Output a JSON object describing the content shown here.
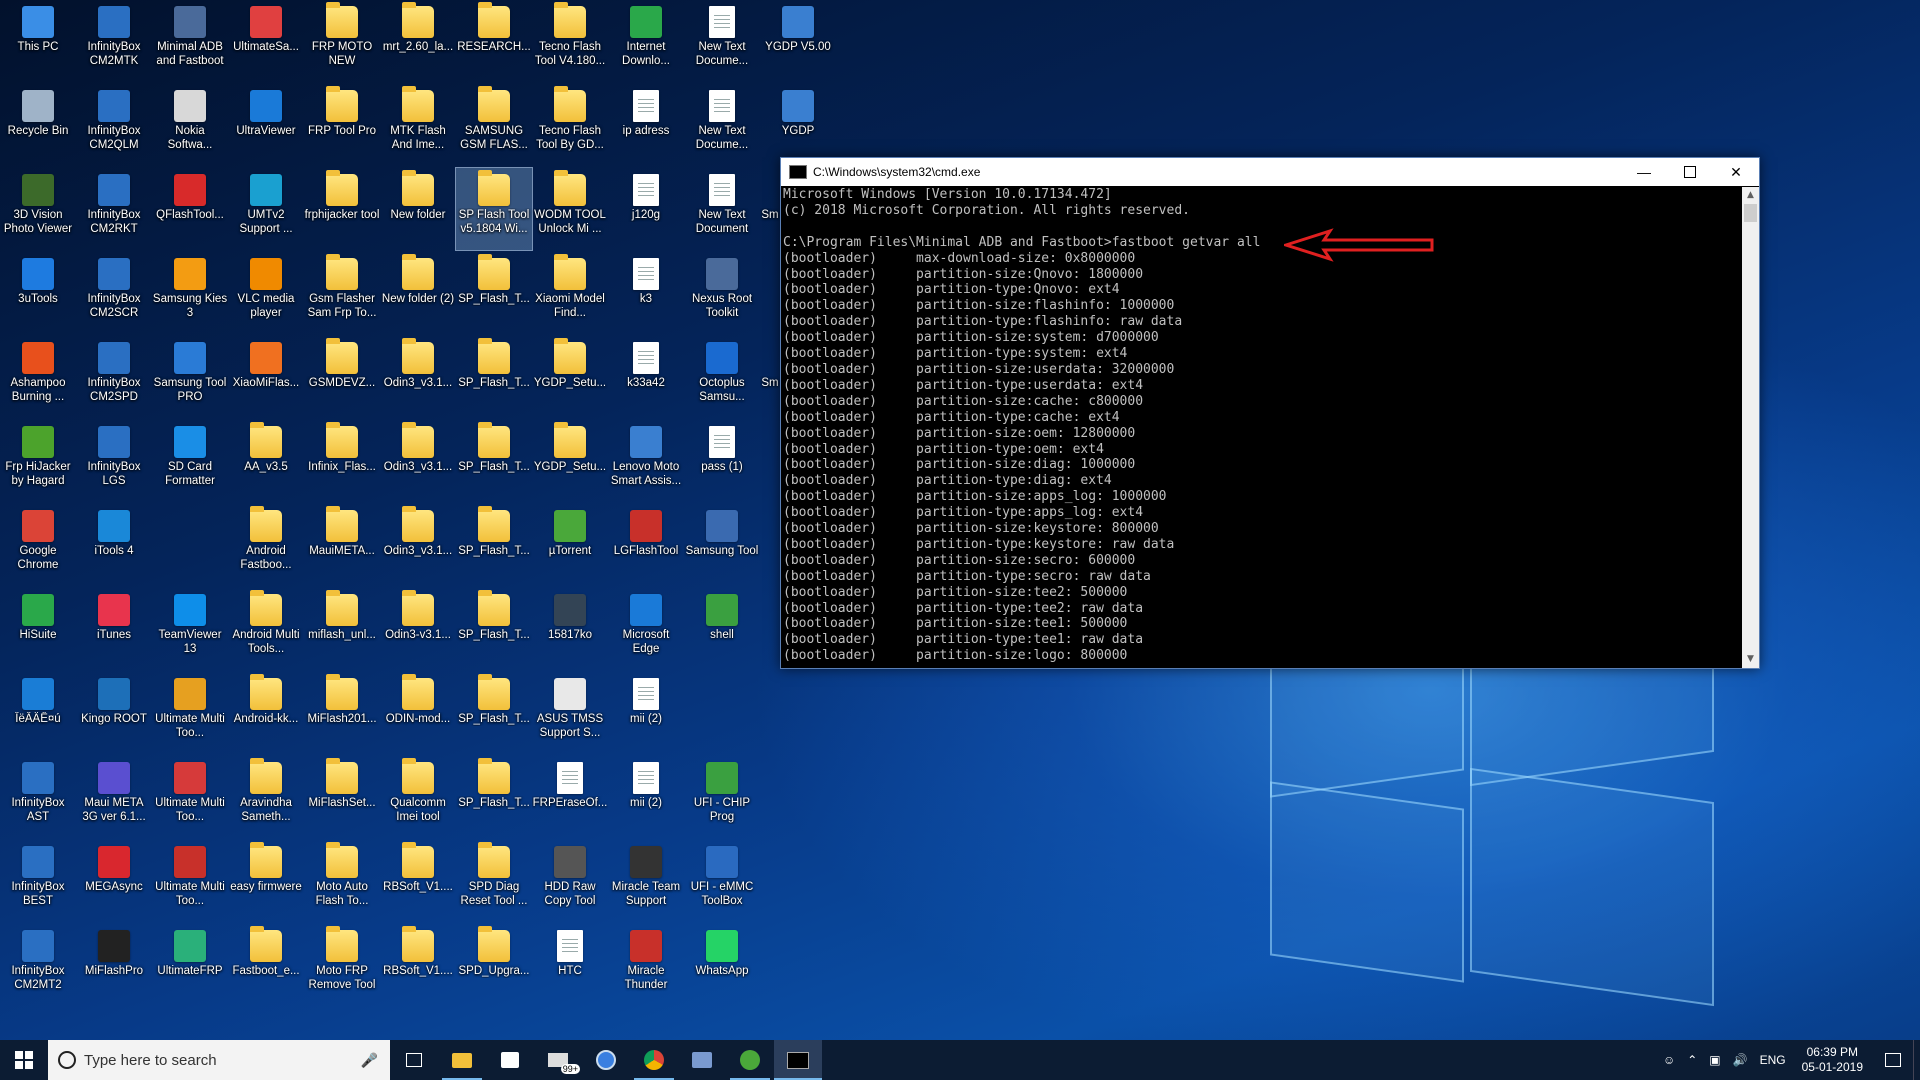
{
  "desktop": {
    "columns": [
      [
        {
          "label": "This PC",
          "icon": "this-pc-icon",
          "color": "#3a8ee6"
        },
        {
          "label": "Recycle Bin",
          "icon": "recycle-bin-icon",
          "color": "#9fb3c8"
        },
        {
          "label": "3D Vision Photo Viewer",
          "icon": "3d-vision-icon",
          "color": "#3c6a2a"
        },
        {
          "label": "3uTools",
          "icon": "3utools-icon",
          "color": "#1e7be0"
        },
        {
          "label": "Ashampoo Burning ...",
          "icon": "ashampoo-icon",
          "color": "#e8501c"
        },
        {
          "label": "Frp HiJacker by Hagard",
          "icon": "frp-hijacker-icon",
          "color": "#4ca32c"
        },
        {
          "label": "Google Chrome",
          "icon": "chrome-icon",
          "color": "#db4437"
        },
        {
          "label": "HiSuite",
          "icon": "hisuite-icon",
          "color": "#2aa84a"
        },
        {
          "label": "ÎëÂÄÊ¤ú",
          "icon": "tool-icon",
          "color": "#1a7dd6"
        },
        {
          "label": "InfinityBox AST",
          "icon": "infinitybox-icon",
          "color": "#2a6fc2"
        },
        {
          "label": "InfinityBox BEST",
          "icon": "infinitybox-icon",
          "color": "#2a6fc2"
        },
        {
          "label": "InfinityBox CM2MT2",
          "icon": "infinitybox-icon",
          "color": "#2a6fc2"
        }
      ],
      [
        {
          "label": "InfinityBox CM2MTK",
          "icon": "infinitybox-icon",
          "color": "#2a6fc2"
        },
        {
          "label": "InfinityBox CM2QLM",
          "icon": "infinitybox-icon",
          "color": "#2a6fc2"
        },
        {
          "label": "InfinityBox CM2RKT",
          "icon": "infinitybox-icon",
          "color": "#2a6fc2"
        },
        {
          "label": "InfinityBox CM2SCR",
          "icon": "infinitybox-icon",
          "color": "#2a6fc2"
        },
        {
          "label": "InfinityBox CM2SPD",
          "icon": "infinitybox-icon",
          "color": "#2a6fc2"
        },
        {
          "label": "InfinityBox LGS",
          "icon": "infinitybox-icon",
          "color": "#2a6fc2"
        },
        {
          "label": "iTools 4",
          "icon": "itools-icon",
          "color": "#1a88d8"
        },
        {
          "label": "iTunes",
          "icon": "itunes-icon",
          "color": "#e8344d"
        },
        {
          "label": "Kingo ROOT",
          "icon": "kingo-root-icon",
          "color": "#1d6fb8"
        },
        {
          "label": "Maui META 3G ver 6.1...",
          "icon": "maui-meta-icon",
          "color": "#5a4fd0"
        },
        {
          "label": "MEGAsync",
          "icon": "megasync-icon",
          "color": "#d9272e"
        },
        {
          "label": "MiFlashPro",
          "icon": "miflashpro-icon",
          "color": "#222222"
        }
      ],
      [
        {
          "label": "Minimal ADB and Fastboot",
          "icon": "adb-icon",
          "color": "#4a6a9a"
        },
        {
          "label": "Nokia Softwa...",
          "icon": "nokia-icon",
          "color": "#d8d8d8"
        },
        {
          "label": "QFlashTool...",
          "icon": "qflashtool-icon",
          "color": "#d82a2a"
        },
        {
          "label": "Samsung Kies 3",
          "icon": "kies-icon",
          "color": "#f39c12"
        },
        {
          "label": "Samsung Tool PRO",
          "icon": "samsung-tool-icon",
          "color": "#2a7bd6"
        },
        {
          "label": "SD Card Formatter",
          "icon": "sd-card-icon",
          "color": "#1a8ee6"
        },
        {
          "label": "",
          "icon": "",
          "color": ""
        },
        {
          "label": "TeamViewer 13",
          "icon": "teamviewer-icon",
          "color": "#0e8ee9"
        },
        {
          "label": "Ultimate Multi Too...",
          "icon": "ultimate-multi-tool-icon",
          "color": "#e6a020"
        },
        {
          "label": "Ultimate Multi Too...",
          "icon": "ultimate-multi-tool-icon",
          "color": "#d63a3a"
        },
        {
          "label": "Ultimate Multi Too...",
          "icon": "ultimate-multi-tool-icon",
          "color": "#c8302a"
        },
        {
          "label": "UltimateFRP",
          "icon": "ultimatefrp-icon",
          "color": "#2ab07a"
        }
      ],
      [
        {
          "label": "UltimateSa...",
          "icon": "ultimatesa-icon",
          "color": "#e04040"
        },
        {
          "label": "UltraViewer",
          "icon": "ultraviewer-icon",
          "color": "#1a7ad8"
        },
        {
          "label": "UMTv2 Support ...",
          "icon": "umt-icon",
          "color": "#1aa0d0"
        },
        {
          "label": "VLC media player",
          "icon": "vlc-icon",
          "color": "#f08a00"
        },
        {
          "label": "XiaoMiFlas...",
          "icon": "xiaomi-icon",
          "color": "#f07020"
        },
        {
          "label": "AA_v3.5",
          "icon": "folder-icon",
          "color": "folder"
        },
        {
          "label": "Android Fastboo...",
          "icon": "folder-icon",
          "color": "folder"
        },
        {
          "label": "Android Multi Tools...",
          "icon": "folder-icon",
          "color": "folder"
        },
        {
          "label": "Android-kk...",
          "icon": "folder-icon",
          "color": "folder"
        },
        {
          "label": "Aravindha Sameth...",
          "icon": "folder-icon",
          "color": "folder"
        },
        {
          "label": "easy firmwere",
          "icon": "folder-icon",
          "color": "folder"
        },
        {
          "label": "Fastboot_e...",
          "icon": "folder-icon",
          "color": "folder"
        }
      ],
      [
        {
          "label": "FRP MOTO NEW",
          "icon": "folder-icon",
          "color": "folder"
        },
        {
          "label": "FRP Tool Pro",
          "icon": "folder-icon",
          "color": "folder"
        },
        {
          "label": "frphijacker tool",
          "icon": "folder-icon",
          "color": "folder"
        },
        {
          "label": "Gsm Flasher Sam Frp To...",
          "icon": "folder-icon",
          "color": "folder"
        },
        {
          "label": "GSMDEVZ...",
          "icon": "folder-icon",
          "color": "folder"
        },
        {
          "label": "Infinix_Flas...",
          "icon": "folder-icon",
          "color": "folder"
        },
        {
          "label": "MauiMETA...",
          "icon": "folder-icon",
          "color": "folder"
        },
        {
          "label": "miflash_unl...",
          "icon": "folder-icon",
          "color": "folder"
        },
        {
          "label": "MiFlash201...",
          "icon": "folder-icon",
          "color": "folder"
        },
        {
          "label": "MiFlashSet...",
          "icon": "folder-icon",
          "color": "folder"
        },
        {
          "label": "Moto Auto Flash To...",
          "icon": "folder-icon",
          "color": "folder"
        },
        {
          "label": "Moto FRP Remove Tool",
          "icon": "folder-icon",
          "color": "folder"
        }
      ],
      [
        {
          "label": "mrt_2.60_la...",
          "icon": "folder-icon",
          "color": "folder"
        },
        {
          "label": "MTK Flash And Ime...",
          "icon": "folder-icon",
          "color": "folder"
        },
        {
          "label": "New folder",
          "icon": "folder-icon",
          "color": "folder"
        },
        {
          "label": "New folder (2)",
          "icon": "folder-icon",
          "color": "folder"
        },
        {
          "label": "Odin3_v3.1...",
          "icon": "folder-icon",
          "color": "folder"
        },
        {
          "label": "Odin3_v3.1...",
          "icon": "folder-icon",
          "color": "folder"
        },
        {
          "label": "Odin3_v3.1...",
          "icon": "folder-icon",
          "color": "folder"
        },
        {
          "label": "Odin3-v3.1...",
          "icon": "folder-icon",
          "color": "folder"
        },
        {
          "label": "ODIN-mod...",
          "icon": "folder-icon",
          "color": "folder"
        },
        {
          "label": "Qualcomm Imei tool",
          "icon": "folder-icon",
          "color": "folder"
        },
        {
          "label": "RBSoft_V1....",
          "icon": "folder-icon",
          "color": "folder"
        },
        {
          "label": "RBSoft_V1....",
          "icon": "folder-icon",
          "color": "folder"
        }
      ],
      [
        {
          "label": "RESEARCH...",
          "icon": "folder-icon",
          "color": "folder"
        },
        {
          "label": "SAMSUNG GSM FLAS...",
          "icon": "folder-icon",
          "color": "folder"
        },
        {
          "label": "SP Flash Tool v5.1804 Wi...",
          "icon": "folder-icon",
          "color": "folder",
          "selected": true
        },
        {
          "label": "SP_Flash_T...",
          "icon": "folder-icon",
          "color": "folder"
        },
        {
          "label": "SP_Flash_T...",
          "icon": "folder-icon",
          "color": "folder"
        },
        {
          "label": "SP_Flash_T...",
          "icon": "folder-icon",
          "color": "folder"
        },
        {
          "label": "SP_Flash_T...",
          "icon": "folder-icon",
          "color": "folder"
        },
        {
          "label": "SP_Flash_T...",
          "icon": "folder-icon",
          "color": "folder"
        },
        {
          "label": "SP_Flash_T...",
          "icon": "folder-icon",
          "color": "folder"
        },
        {
          "label": "SP_Flash_T...",
          "icon": "folder-icon",
          "color": "folder"
        },
        {
          "label": "SPD Diag Reset Tool ...",
          "icon": "folder-icon",
          "color": "folder"
        },
        {
          "label": "SPD_Upgra...",
          "icon": "folder-icon",
          "color": "folder"
        }
      ],
      [
        {
          "label": "Tecno Flash Tool V4.180...",
          "icon": "folder-icon",
          "color": "folder"
        },
        {
          "label": "Tecno Flash Tool By GD...",
          "icon": "folder-icon",
          "color": "folder"
        },
        {
          "label": "WODM TOOL Unlock Mi ...",
          "icon": "folder-icon",
          "color": "folder"
        },
        {
          "label": "Xiaomi Model Find...",
          "icon": "folder-icon",
          "color": "folder"
        },
        {
          "label": "YGDP_Setu...",
          "icon": "folder-icon",
          "color": "folder"
        },
        {
          "label": "YGDP_Setu...",
          "icon": "folder-icon",
          "color": "folder"
        },
        {
          "label": "µTorrent",
          "icon": "utorrent-icon",
          "color": "#4aa83a"
        },
        {
          "label": "15817ko",
          "icon": "file-icon",
          "color": "#334455"
        },
        {
          "label": "ASUS TMSS Support S...",
          "icon": "asus-icon",
          "color": "#e8e8e8"
        },
        {
          "label": "FRPEraseOf...",
          "icon": "document-icon",
          "color": "doc"
        },
        {
          "label": "HDD Raw Copy Tool",
          "icon": "hdd-icon",
          "color": "#555555"
        },
        {
          "label": "HTC",
          "icon": "document-icon",
          "color": "doc"
        }
      ],
      [
        {
          "label": "Internet Downlo...",
          "icon": "idm-icon",
          "color": "#2aa84a"
        },
        {
          "label": "ip adress",
          "icon": "document-icon",
          "color": "doc"
        },
        {
          "label": "j120g",
          "icon": "document-icon",
          "color": "doc"
        },
        {
          "label": "k3",
          "icon": "document-icon",
          "color": "doc"
        },
        {
          "label": "k33a42",
          "icon": "document-icon",
          "color": "doc"
        },
        {
          "label": "Lenovo Moto Smart Assis...",
          "icon": "lenovo-icon",
          "color": "#3a7fd0"
        },
        {
          "label": "LGFlashTool",
          "icon": "lgflashtool-icon",
          "color": "#c8302a"
        },
        {
          "label": "Microsoft Edge",
          "icon": "edge-icon",
          "color": "#1a7ad8"
        },
        {
          "label": "mii (2)",
          "icon": "document-icon",
          "color": "doc"
        },
        {
          "label": "mii (2)",
          "icon": "document-icon",
          "color": "doc"
        },
        {
          "label": "Miracle Team Support",
          "icon": "miracle-icon",
          "color": "#333333"
        },
        {
          "label": "Miracle Thunder",
          "icon": "miracle-thunder-icon",
          "color": "#c8302a"
        }
      ],
      [
        {
          "label": "New Text Docume...",
          "icon": "text-document-icon",
          "color": "doc"
        },
        {
          "label": "New Text Docume...",
          "icon": "text-document-icon",
          "color": "doc"
        },
        {
          "label": "New Text Document",
          "icon": "text-document-icon",
          "color": "doc"
        },
        {
          "label": "Nexus Root Toolkit",
          "icon": "nexus-icon",
          "color": "#4a6a9a"
        },
        {
          "label": "Octoplus Samsu...",
          "icon": "octoplus-icon",
          "color": "#1a6ad0"
        },
        {
          "label": "pass (1)",
          "icon": "text-document-icon",
          "color": "doc"
        },
        {
          "label": "Samsung Tool",
          "icon": "samsung-tool-icon",
          "color": "#3a6ab0"
        },
        {
          "label": "shell",
          "icon": "shell-icon",
          "color": "#3aa040"
        },
        {
          "label": "",
          "icon": "",
          "color": ""
        },
        {
          "label": "UFI - CHIP Prog",
          "icon": "ufi-icon",
          "color": "#3aa040"
        },
        {
          "label": "UFI - eMMC ToolBox",
          "icon": "ufi-icon",
          "color": "#2a6ac0"
        },
        {
          "label": "WhatsApp",
          "icon": "whatsapp-icon",
          "color": "#25d366"
        }
      ],
      [
        {
          "label": "YGDP V5.00",
          "icon": "ygdp-icon",
          "color": "#3a7fd0"
        },
        {
          "label": "YGDP",
          "icon": "ygdp-icon",
          "color": "#3a7fd0"
        },
        {
          "label": "Sm",
          "icon": "",
          "color": ""
        },
        {
          "label": "",
          "icon": "",
          "color": ""
        },
        {
          "label": "Sm",
          "icon": "",
          "color": ""
        }
      ]
    ]
  },
  "cmd": {
    "title": "C:\\Windows\\system32\\cmd.exe",
    "lines": [
      "Microsoft Windows [Version 10.0.17134.472]",
      "(c) 2018 Microsoft Corporation. All rights reserved.",
      "",
      "C:\\Program Files\\Minimal ADB and Fastboot>fastboot getvar all",
      "(bootloader)     max-download-size: 0x8000000",
      "(bootloader)     partition-size:Qnovo: 1800000",
      "(bootloader)     partition-type:Qnovo: ext4",
      "(bootloader)     partition-size:flashinfo: 1000000",
      "(bootloader)     partition-type:flashinfo: raw data",
      "(bootloader)     partition-size:system: d7000000",
      "(bootloader)     partition-type:system: ext4",
      "(bootloader)     partition-size:userdata: 32000000",
      "(bootloader)     partition-type:userdata: ext4",
      "(bootloader)     partition-size:cache: c800000",
      "(bootloader)     partition-type:cache: ext4",
      "(bootloader)     partition-size:oem: 12800000",
      "(bootloader)     partition-type:oem: ext4",
      "(bootloader)     partition-size:diag: 1000000",
      "(bootloader)     partition-type:diag: ext4",
      "(bootloader)     partition-size:apps_log: 1000000",
      "(bootloader)     partition-type:apps_log: ext4",
      "(bootloader)     partition-size:keystore: 800000",
      "(bootloader)     partition-type:keystore: raw data",
      "(bootloader)     partition-size:secro: 600000",
      "(bootloader)     partition-type:secro: raw data",
      "(bootloader)     partition-size:tee2: 500000",
      "(bootloader)     partition-type:tee2: raw data",
      "(bootloader)     partition-size:tee1: 500000",
      "(bootloader)     partition-type:tee1: raw data",
      "(bootloader)     partition-size:logo: 800000"
    ]
  },
  "annotation": {
    "arrow_color": "#e02020"
  },
  "taskbar": {
    "search_placeholder": "Type here to search",
    "badge": "99+",
    "language": "ENG",
    "time": "06:39 PM",
    "date": "05-01-2019"
  }
}
